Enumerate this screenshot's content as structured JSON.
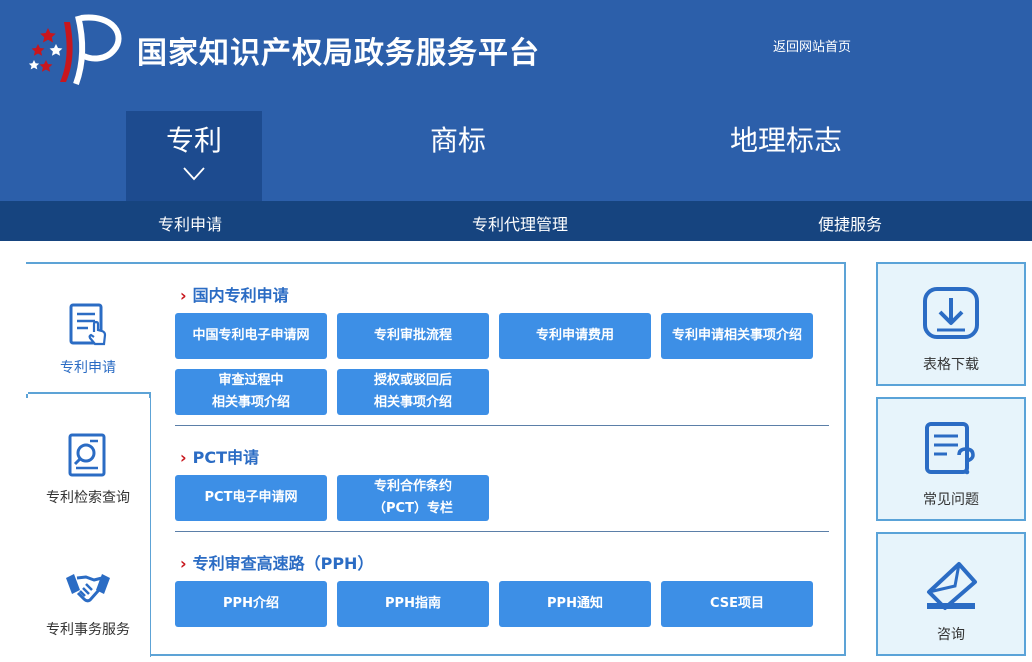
{
  "header": {
    "title": "国家知识产权局政务服务平台",
    "home_link": "返回网站首页"
  },
  "main_nav": [
    {
      "label": "专利",
      "active": true
    },
    {
      "label": "商标",
      "active": false
    },
    {
      "label": "地理标志",
      "active": false
    }
  ],
  "sub_nav": [
    "专利申请",
    "专利代理管理",
    "便捷服务"
  ],
  "side_tabs": [
    {
      "label": "专利申请",
      "icon": "document-edit-icon",
      "active": true
    },
    {
      "label": "专利检索查询",
      "icon": "search-document-icon",
      "active": false
    },
    {
      "label": "专利事务服务",
      "icon": "handshake-icon",
      "active": false
    }
  ],
  "sections": [
    {
      "title": "国内专利申请",
      "buttons": [
        "中国专利电子申请网",
        "专利审批流程",
        "专利申请费用",
        "专利申请相关事项介绍",
        "审查过程中\n相关事项介绍",
        "授权或驳回后\n相关事项介绍"
      ]
    },
    {
      "title": "PCT申请",
      "buttons": [
        "PCT电子申请网",
        "专利合作条约\n（PCT）专栏"
      ]
    },
    {
      "title": "专利审查高速路（PPH）",
      "buttons": [
        "PPH介绍",
        "PPH指南",
        "PPH通知",
        "CSE项目"
      ]
    }
  ],
  "cards": [
    {
      "label": "表格下载",
      "icon": "download-icon"
    },
    {
      "label": "常见问题",
      "icon": "faq-icon"
    },
    {
      "label": "咨询",
      "icon": "envelope-icon"
    }
  ],
  "colors": {
    "header_bg": "#2c5faa",
    "active_tab_bg": "#1d4b8f",
    "sub_nav_bg": "#16447f",
    "button_bg": "#3d8fe6",
    "accent_red": "#c8161d",
    "card_bg": "#e7f4fb"
  }
}
